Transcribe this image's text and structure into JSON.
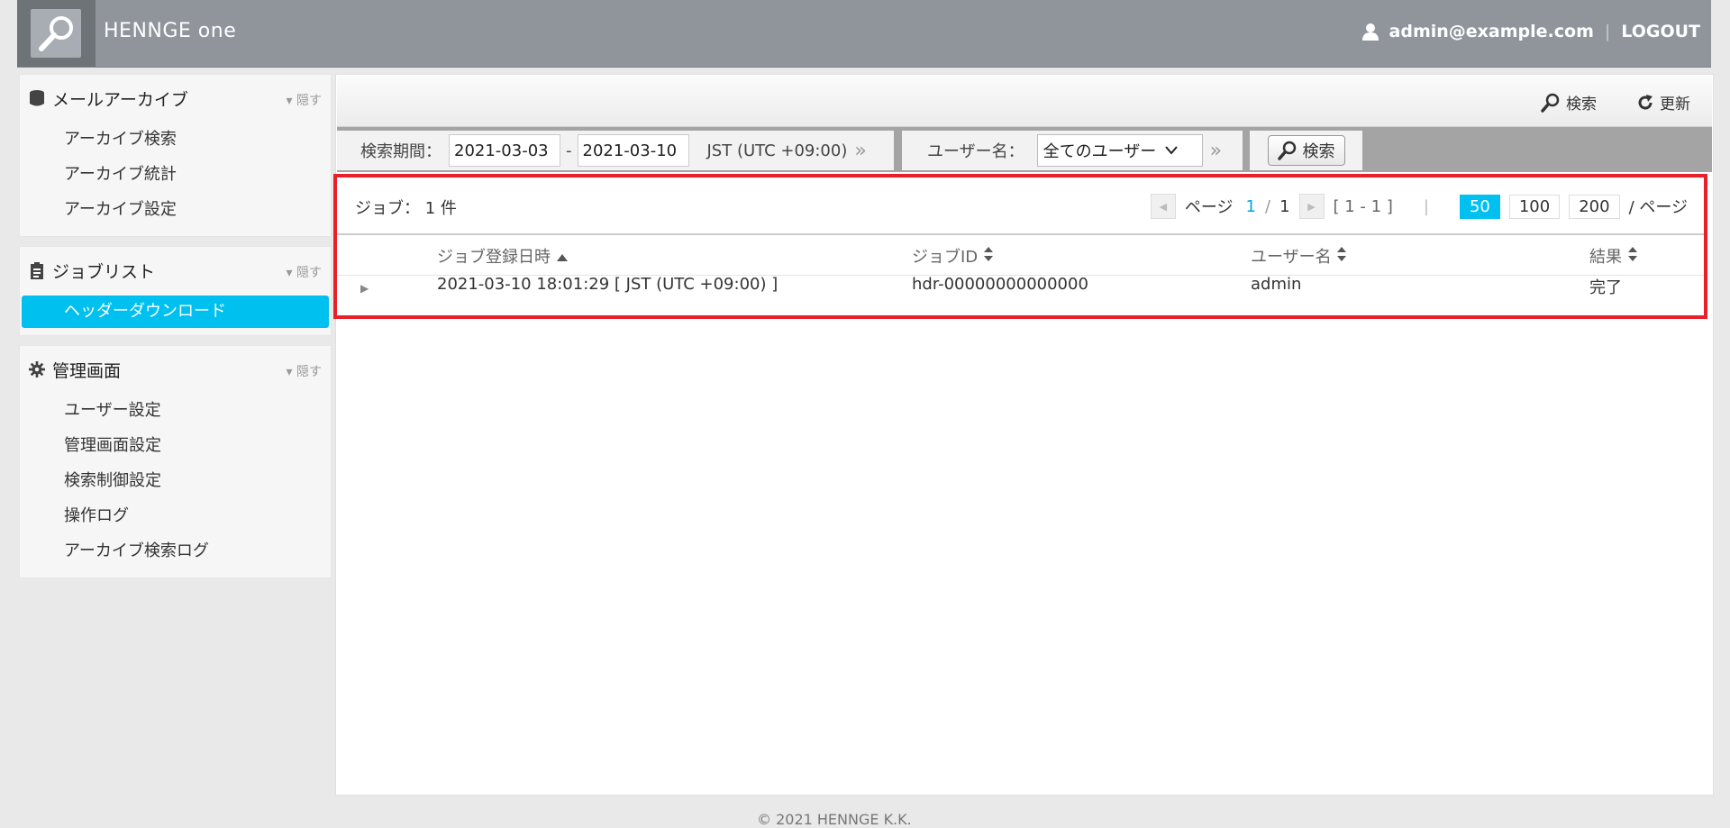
{
  "header": {
    "logo": "HENNGE one",
    "user_email": "admin@example.com",
    "separator": "|",
    "logout": "LOGOUT"
  },
  "sidebar": {
    "groups": [
      {
        "title": "メールアーカイブ",
        "hide": "隠す",
        "items": [
          "アーカイブ検索",
          "アーカイブ統計",
          "アーカイブ設定"
        ]
      },
      {
        "title": "ジョブリスト",
        "hide": "隠す",
        "items": [
          "ヘッダーダウンロード"
        ]
      },
      {
        "title": "管理画面",
        "hide": "隠す",
        "items": [
          "ユーザー設定",
          "管理画面設定",
          "検索制御設定",
          "操作ログ",
          "アーカイブ検索ログ"
        ]
      }
    ]
  },
  "toolbar": {
    "search": "検索",
    "refresh": "更新"
  },
  "filter": {
    "period_label": "検索期間：",
    "date_from": "2021-03-03",
    "dash": "-",
    "date_to": "2021-03-10",
    "timezone": "JST (UTC +09:00)",
    "user_label": "ユーザー名：",
    "user_select": "全てのユーザー",
    "search_button": "検索",
    "chevrons": "»"
  },
  "jobs": {
    "label": "ジョブ：",
    "count": "1 件",
    "pager": {
      "page_label": "ページ",
      "current": "1",
      "slash": "/",
      "total": "1",
      "range": "[ 1 - 1 ]",
      "divider": "|",
      "sizes": [
        "50",
        "100",
        "200"
      ],
      "active_size": "50",
      "per_page_label": "/ ページ"
    },
    "columns": {
      "date": "ジョブ登録日時",
      "id": "ジョブID",
      "user": "ユーザー名",
      "result": "結果"
    },
    "rows": [
      {
        "date": "2021-03-10 18:01:29 [ JST (UTC +09:00) ]",
        "id": "hdr-00000000000000",
        "user": "admin",
        "result": "完了"
      }
    ]
  },
  "footer": {
    "copyright": "© 2021 HENNGE K.K."
  }
}
